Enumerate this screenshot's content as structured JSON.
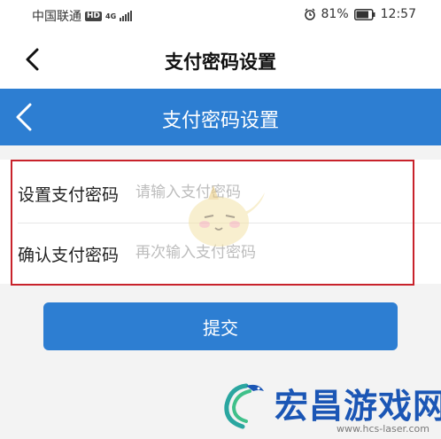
{
  "status_bar": {
    "carrier": "中国联通",
    "hd_badge": "HD",
    "network_type": "4G",
    "battery_percent": "81%",
    "time": "12:57"
  },
  "app_bar": {
    "title": "支付密码设置"
  },
  "blue_header": {
    "title": "支付密码设置"
  },
  "form": {
    "set_password": {
      "label": "设置支付密码",
      "placeholder": "请输入支付密码",
      "value": ""
    },
    "confirm_password": {
      "label": "确认支付密码",
      "placeholder": "再次输入支付密码",
      "value": ""
    }
  },
  "submit_button": {
    "label": "提交"
  },
  "watermark": {
    "site_name": "宏昌游戏网",
    "url": "www.hcs-laser.com"
  },
  "colors": {
    "accent_blue": "#2d7ed2",
    "highlight_red": "#c8222b",
    "watermark_blue": "#1b56b5"
  }
}
